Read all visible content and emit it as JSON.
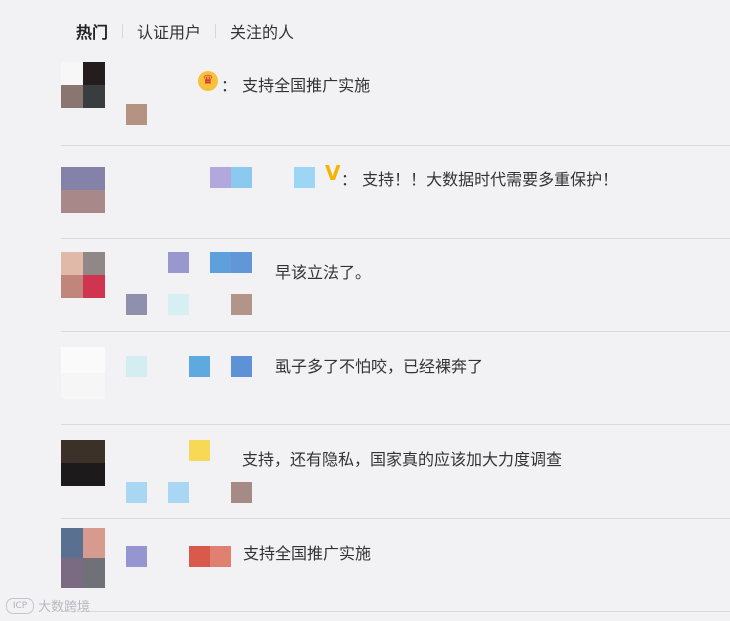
{
  "tabs": [
    "热门",
    "认证用户",
    "关注的人"
  ],
  "comments": [
    {
      "text": "：  支持全国推广实施",
      "badge": "crown-badge"
    },
    {
      "text": "：  支持！！大数据时代需要多重保护！",
      "badge": "v-badge",
      "badge_text": "V"
    },
    {
      "text": "早该立法了。"
    },
    {
      "text": "虱子多了不怕咬，已经裸奔了"
    },
    {
      "text": "支持，还有隐私，国家真的应该加大力度调查"
    },
    {
      "text": "支持全国推广实施"
    }
  ],
  "watermark": {
    "logo": "ICP",
    "text": "大数跨境"
  },
  "colors": {
    "background": "#f2f2f5",
    "divider": "#d9d9de",
    "vip": "#f5b400"
  }
}
